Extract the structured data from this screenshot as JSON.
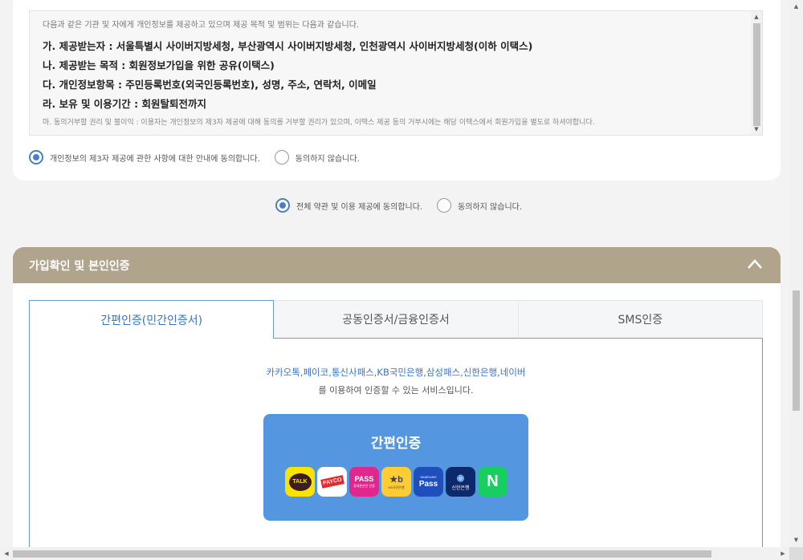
{
  "consent_card": {
    "intro": "다음과 같은 기관 및 자에게 개인정보를 제공하고 있으며 제공 목적 및 범위는 다음과 같습니다.",
    "items": [
      "가. 제공받는자 : 서울특별시 사이버지방세청, 부산광역시 사이버지방세청, 인천광역시 사이버지방세청(이하 이택스)",
      "나. 제공받는 목적 : 회원정보가입을 위한 공유(이택스)",
      "다. 개인정보항목 : 주민등록번호(외국인등록번호), 성명, 주소, 연락처, 이메일",
      "라. 보유 및 이용기간 : 회원탈퇴전까지"
    ],
    "note": "마. 동의거부할 권리 및 불이익 : 이용자는 개인정보의 제3자 제공에 대해 동의를 거부할 권리가 있으며, 이택스 제공 동의 거부시에는 해당 이택스에서 회원가입을 별도로 하셔야합니다.",
    "agree_label": "개인정보의 제3자 제공에 관한 사항에 대한 안내에 동의합니다.",
    "disagree_label": "동의하지 않습니다."
  },
  "all_consent": {
    "agree_label": "전체 약관 및 이용 제공에 동의합니다.",
    "disagree_label": "동의하지 않습니다."
  },
  "auth": {
    "title": "가입확인 및 본인인증",
    "tabs": [
      "간편인증(민간인증서)",
      "공동인증서/금융인증서",
      "SMS인증"
    ],
    "service_list": "카카오톡,페이코,통신사패스,KB국민은행,삼성패스,신한은행,네이버",
    "service_desc": "를 이용하여 인증할 수 있는 서비스입니다.",
    "easy_button_label": "간편인증",
    "logos": [
      {
        "icon": "kakaotalk-icon",
        "text": "TALK",
        "sub": ""
      },
      {
        "icon": "payco-icon",
        "text": "PAYCO",
        "sub": ""
      },
      {
        "icon": "pass-icon",
        "text": "PASS",
        "sub": "휴대폰본인 인증"
      },
      {
        "icon": "kb-icon",
        "text": "★b",
        "sub": "KB국민은행"
      },
      {
        "icon": "samsung-pass-icon",
        "text": "Pass",
        "sub": "SAMSUNG"
      },
      {
        "icon": "shinhan-icon",
        "text": "◉",
        "sub": "신한은행"
      },
      {
        "icon": "naver-icon",
        "text": "N",
        "sub": ""
      }
    ]
  },
  "colors": {
    "accent": "#4a7fc8",
    "header_bg": "#b1a48c",
    "button_bg": "#5596e0"
  }
}
